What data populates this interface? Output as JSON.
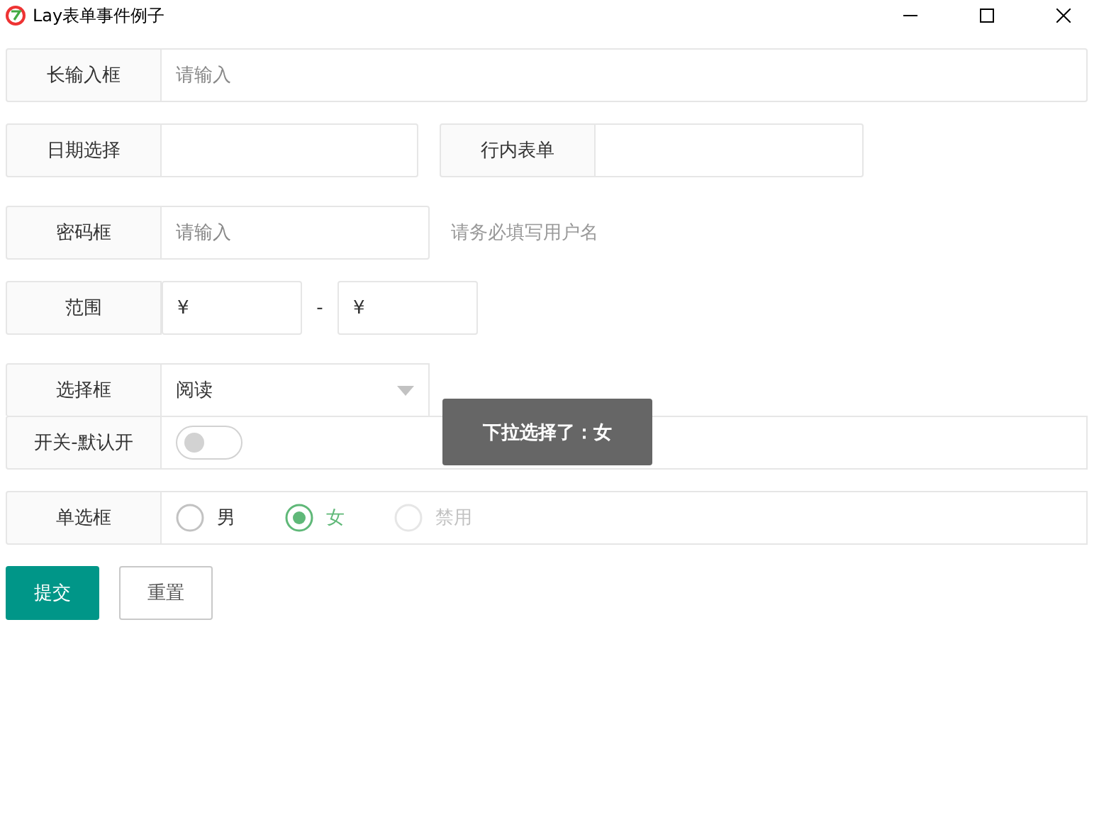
{
  "window": {
    "title": "Lay表单事件例子"
  },
  "long_input": {
    "label": "长输入框",
    "placeholder": "请输入"
  },
  "date": {
    "label": "日期选择"
  },
  "inline": {
    "label": "行内表单"
  },
  "password": {
    "label": "密码框",
    "placeholder": "请输入",
    "hint": "请务必填写用户名"
  },
  "range": {
    "label": "范围",
    "from": "¥",
    "separator": "-",
    "to": "¥"
  },
  "select": {
    "label": "选择框",
    "value": "阅读"
  },
  "switch": {
    "label": "开关-默认开",
    "on": false
  },
  "radio": {
    "label": "单选框",
    "options": [
      {
        "label": "男",
        "selected": false,
        "disabled": false
      },
      {
        "label": "女",
        "selected": true,
        "disabled": false
      },
      {
        "label": "禁用",
        "selected": false,
        "disabled": true
      }
    ]
  },
  "buttons": [
    {
      "label": "提交",
      "kind": "primary"
    },
    {
      "label": "重置",
      "kind": "default"
    }
  ],
  "toast": {
    "text": "下拉选择了：女"
  }
}
